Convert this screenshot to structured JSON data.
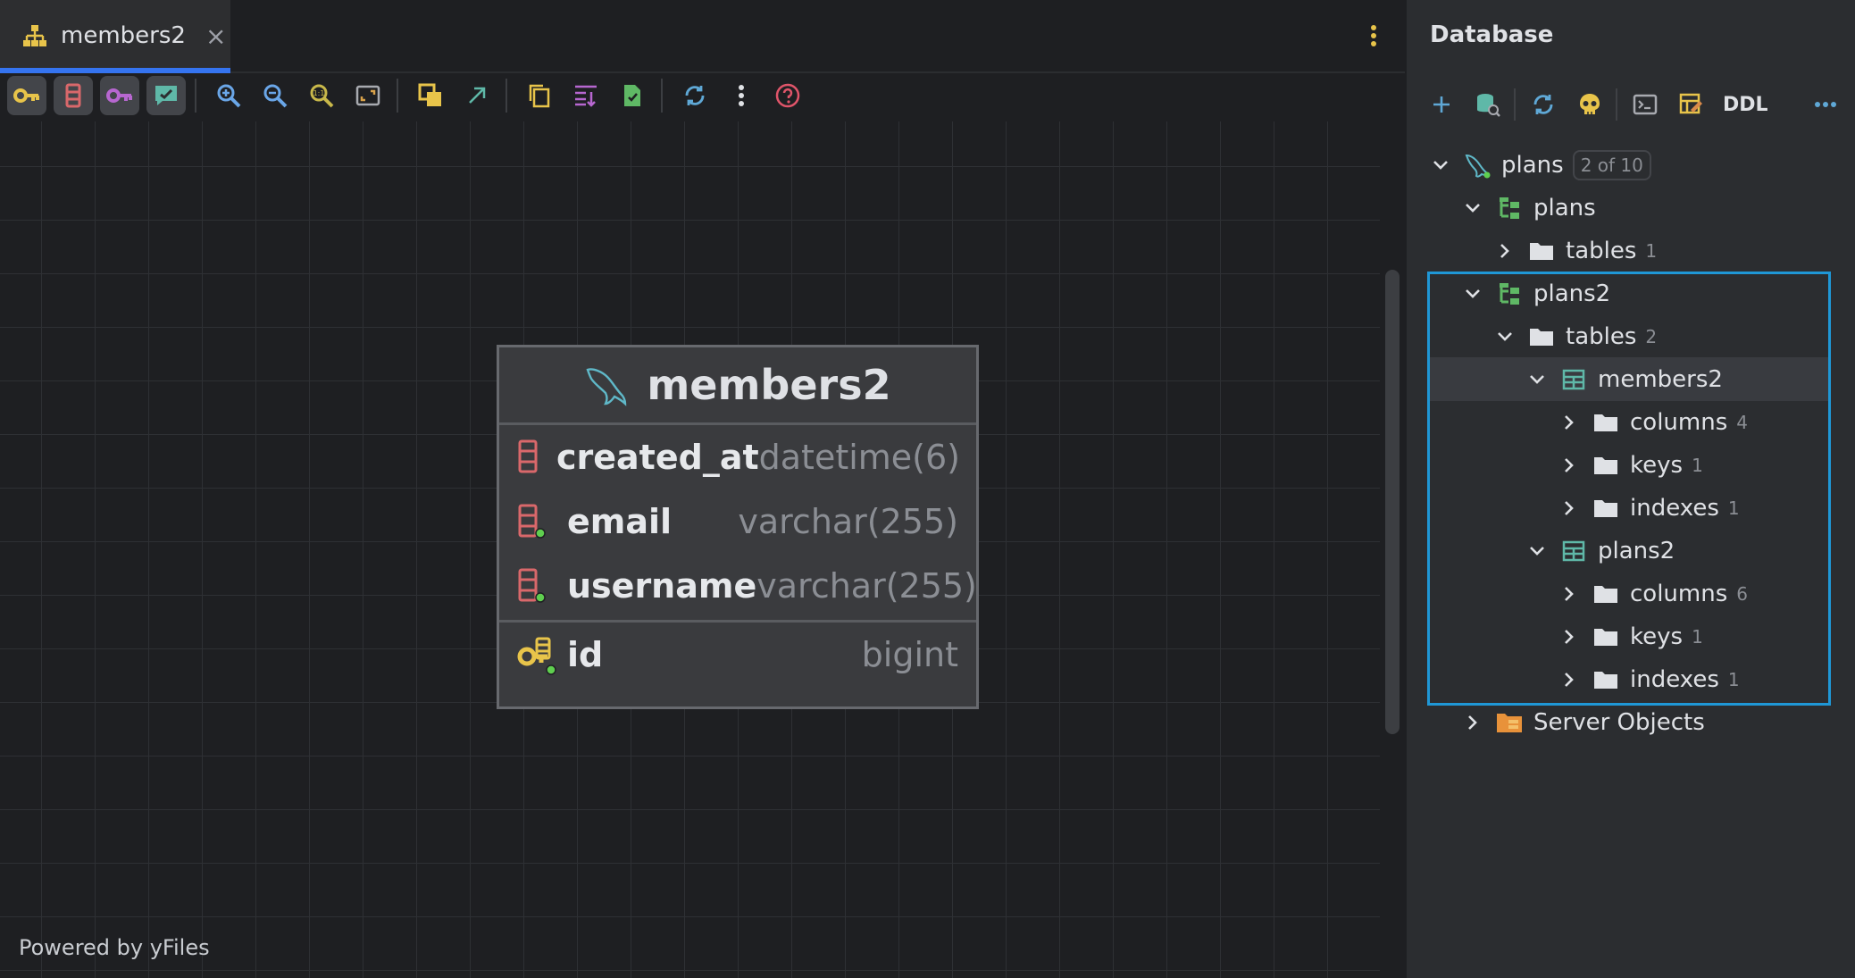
{
  "editor": {
    "tab": {
      "label": "members2",
      "close_symbol": "×",
      "icon": "diagram-icon"
    },
    "more_icon": "vertical-dots-icon",
    "toolbar": [
      {
        "icon": "key-icon",
        "active": true
      },
      {
        "icon": "column-icon",
        "active": true
      },
      {
        "icon": "foreign-key-icon",
        "active": true
      },
      {
        "icon": "comment-icon",
        "active": true
      },
      {
        "icon": "zoom-in-icon",
        "active": false
      },
      {
        "icon": "zoom-out-icon",
        "active": false
      },
      {
        "icon": "actual-size-icon",
        "active": false
      },
      {
        "icon": "fit-content-icon",
        "active": false
      },
      {
        "icon": "layout-icon",
        "active": false
      },
      {
        "icon": "arrow-icon",
        "active": false
      },
      {
        "icon": "copy-icon",
        "active": false
      },
      {
        "icon": "align-icon",
        "active": false
      },
      {
        "icon": "export-icon",
        "active": false
      },
      {
        "icon": "refresh-icon",
        "active": false
      },
      {
        "icon": "more-icon",
        "active": false
      },
      {
        "icon": "help-icon",
        "active": false
      }
    ],
    "powered_by": "Powered by yFiles"
  },
  "entity": {
    "title": "members2",
    "icon": "mysql-dolphin-icon",
    "columns": [
      {
        "name": "created_at",
        "type": "datetime(6)",
        "icon": "column-icon",
        "not_null": false
      },
      {
        "name": "email",
        "type": "varchar(255)",
        "icon": "column-icon",
        "not_null": true
      },
      {
        "name": "username",
        "type": "varchar(255)",
        "icon": "column-icon",
        "not_null": true
      }
    ],
    "key_columns": [
      {
        "name": "id",
        "type": "bigint",
        "icon": "primary-key-icon"
      }
    ]
  },
  "database_panel": {
    "title": "Database",
    "toolbar": {
      "buttons": [
        "add-icon",
        "data-source-properties-icon",
        "refresh-icon",
        "skull-icon",
        "console-icon",
        "table-editor-icon"
      ],
      "ddl_label": "DDL",
      "more_icon": "more-icon"
    },
    "tree": [
      {
        "label": "plans",
        "badge": "2 of 10",
        "icon": "mysql-dolphin-icon",
        "expanded": true,
        "level": 0
      },
      {
        "label": "plans",
        "icon": "schema-icon",
        "expanded": true,
        "level": 1
      },
      {
        "label": "tables",
        "count": "1",
        "icon": "folder-icon",
        "expanded": false,
        "level": 2
      },
      {
        "label": "plans2",
        "icon": "schema-icon",
        "expanded": true,
        "level": 1
      },
      {
        "label": "tables",
        "count": "2",
        "icon": "folder-icon",
        "expanded": true,
        "level": 2
      },
      {
        "label": "members2",
        "icon": "table-icon",
        "expanded": true,
        "level": 3,
        "selected": true
      },
      {
        "label": "columns",
        "count": "4",
        "icon": "folder-icon",
        "expanded": false,
        "level": 4
      },
      {
        "label": "keys",
        "count": "1",
        "icon": "folder-icon",
        "expanded": false,
        "level": 4
      },
      {
        "label": "indexes",
        "count": "1",
        "icon": "folder-icon",
        "expanded": false,
        "level": 4
      },
      {
        "label": "plans2",
        "icon": "table-icon",
        "expanded": true,
        "level": 3
      },
      {
        "label": "columns",
        "count": "6",
        "icon": "folder-icon",
        "expanded": false,
        "level": 4
      },
      {
        "label": "keys",
        "count": "1",
        "icon": "folder-icon",
        "expanded": false,
        "level": 4
      },
      {
        "label": "indexes",
        "count": "1",
        "icon": "folder-icon",
        "expanded": false,
        "level": 4
      },
      {
        "label": "Server Objects",
        "icon": "server-objects-icon",
        "expanded": false,
        "level": 1
      }
    ]
  },
  "colors": {
    "accent_blue": "#3574f0",
    "focus_border": "#1f97d6",
    "key_yellow": "#e8c44a",
    "column_red": "#d9686b",
    "fk_purple": "#b767d0",
    "schema_green": "#5fb865",
    "not_null_green": "#5fcf4f"
  }
}
